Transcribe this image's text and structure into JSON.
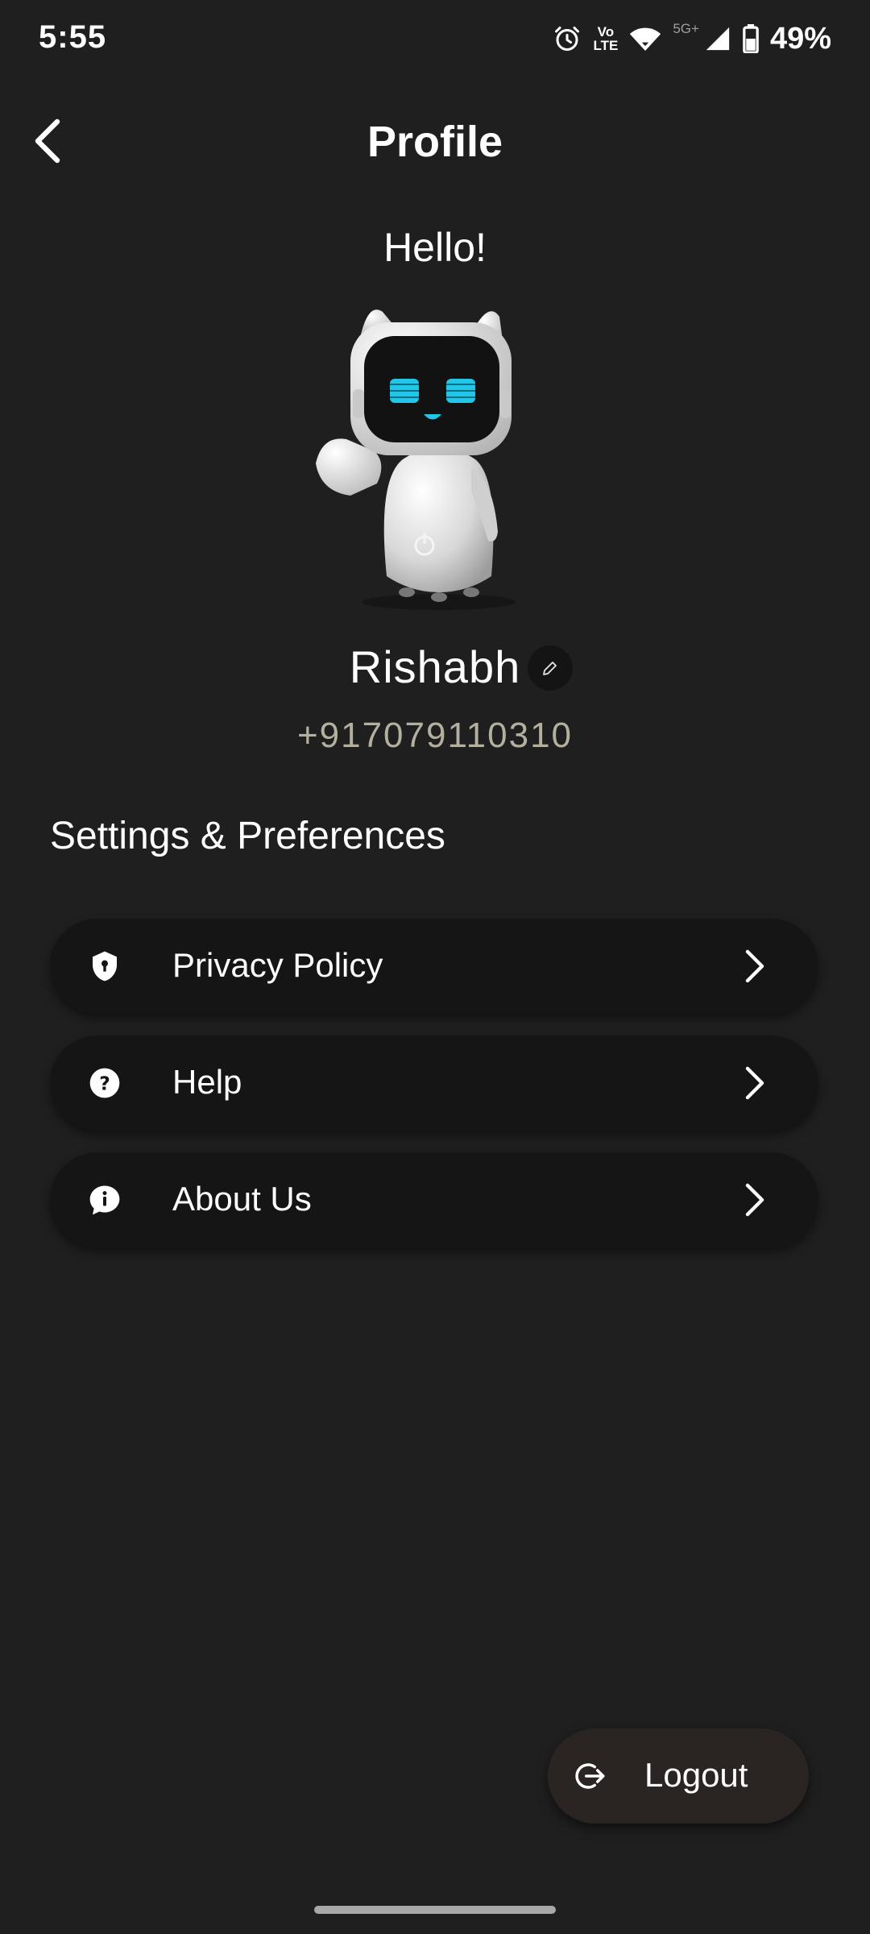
{
  "status_bar": {
    "time": "5:55",
    "volte_top": "Vo",
    "volte_bottom": "LTE",
    "network": "5G+",
    "battery": "49%",
    "icons": [
      "alarm-icon",
      "volte-icon",
      "wifi-icon",
      "signal-icon",
      "battery-icon"
    ]
  },
  "header": {
    "title": "Profile",
    "back_icon": "chevron-left-icon"
  },
  "greeting": "Hello!",
  "profile": {
    "name": "Rishabh",
    "phone": "+917079110310",
    "edit_icon": "pencil-icon",
    "avatar": "robot-avatar"
  },
  "settings": {
    "title": "Settings & Preferences",
    "items": [
      {
        "label": "Privacy Policy",
        "icon": "shield-icon"
      },
      {
        "label": "Help",
        "icon": "help-icon"
      },
      {
        "label": "About Us",
        "icon": "info-chat-icon"
      }
    ]
  },
  "logout": {
    "label": "Logout",
    "icon": "logout-icon"
  },
  "colors": {
    "background": "#1f1f1f",
    "card": "#151515",
    "logout_bg": "#2a2523",
    "phone_text": "#b3b0a0",
    "robot_eyes": "#22c6e6"
  }
}
